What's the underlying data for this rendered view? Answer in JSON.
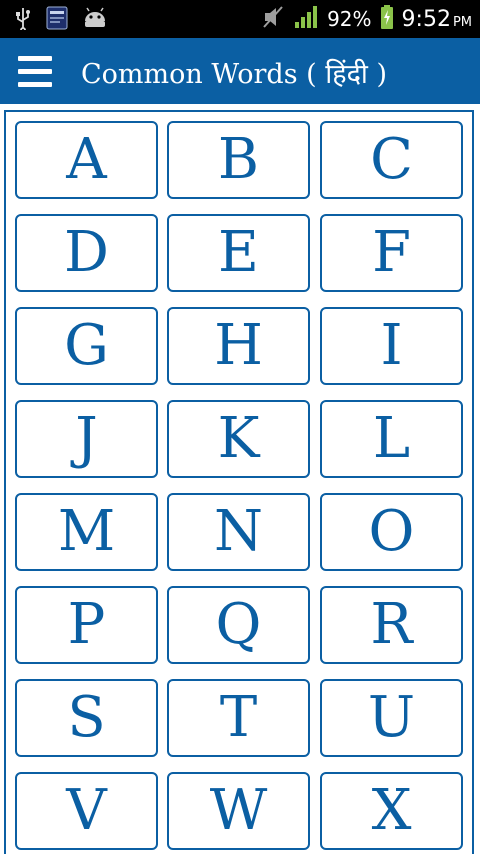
{
  "status_bar": {
    "icons": [
      "usb-icon",
      "news-app-icon",
      "android-icon",
      "mute-icon",
      "signal-icon",
      "battery-icon"
    ],
    "battery": "92%",
    "time": "9:52",
    "ampm": "PM"
  },
  "app_bar": {
    "menu_icon": "hamburger-menu-icon",
    "title": "Common Words ( हिंदी )"
  },
  "colors": {
    "primary": "#0b5fa3",
    "status_bar": "#000000",
    "signal": "#8bc34a"
  },
  "letters": [
    "A",
    "B",
    "C",
    "D",
    "E",
    "F",
    "G",
    "H",
    "I",
    "J",
    "K",
    "L",
    "M",
    "N",
    "O",
    "P",
    "Q",
    "R",
    "S",
    "T",
    "U",
    "V",
    "W",
    "X"
  ]
}
